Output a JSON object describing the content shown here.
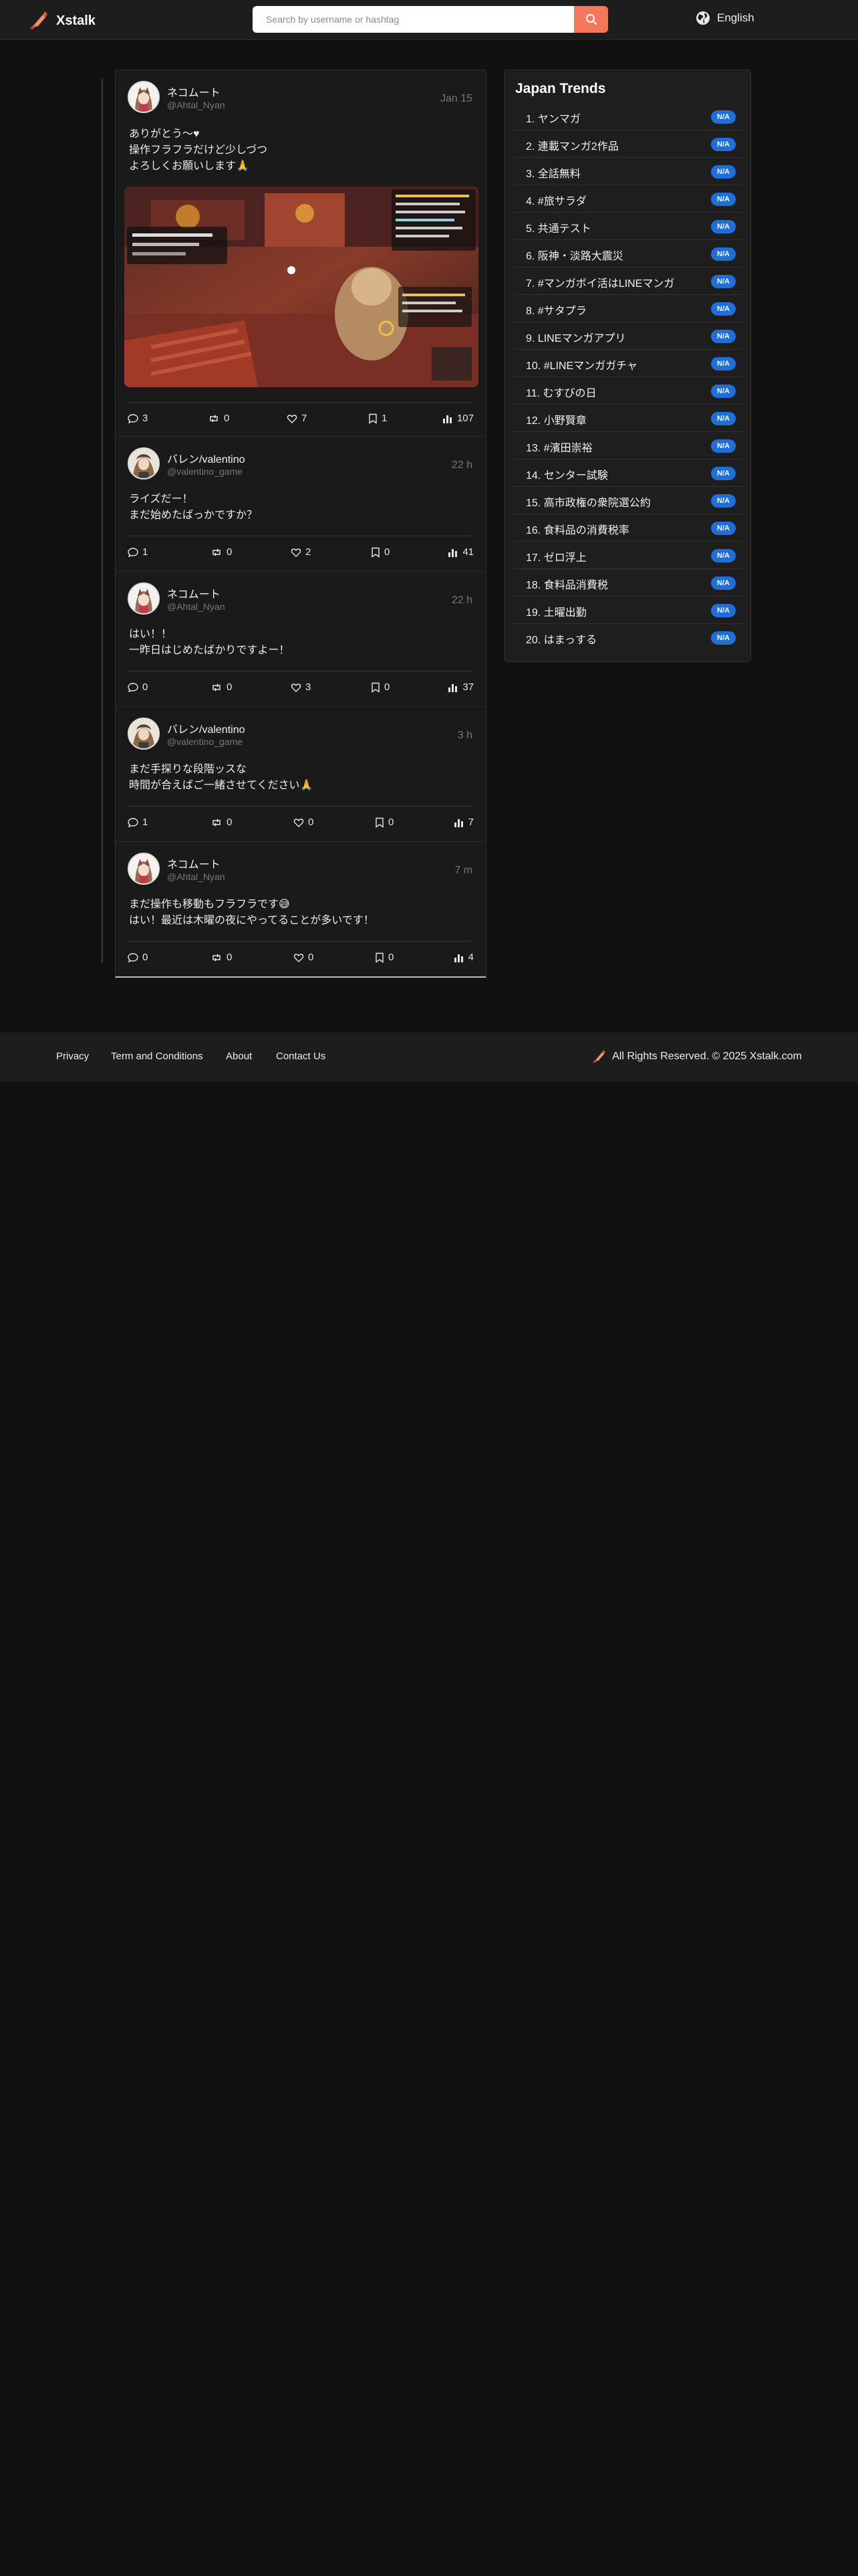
{
  "app": {
    "name": "Xstalk"
  },
  "search": {
    "placeholder": "Search by username or hashtag"
  },
  "language": {
    "label": "English"
  },
  "posts": [
    {
      "name": "ネコムート",
      "handle": "@Ahtal_Nyan",
      "time": "Jan 15",
      "lines": [
        "ありがとう〜♥",
        "操作フラフラだけど少しづつ",
        "よろしくお願いします🙏"
      ],
      "has_image": true,
      "comments": "3",
      "reposts": "0",
      "likes": "7",
      "bookmarks": "1",
      "views": "107"
    },
    {
      "name": "バレン/valentino",
      "handle": "@valentino_game",
      "time": "22 h",
      "lines": [
        "ライズだー！",
        "まだ始めたばっかですか？"
      ],
      "comments": "1",
      "reposts": "0",
      "likes": "2",
      "bookmarks": "0",
      "views": "41"
    },
    {
      "name": "ネコムート",
      "handle": "@Ahtal_Nyan",
      "time": "22 h",
      "lines": [
        "はい！！",
        "一昨日はじめたばかりですよー！"
      ],
      "comments": "0",
      "reposts": "0",
      "likes": "3",
      "bookmarks": "0",
      "views": "37"
    },
    {
      "name": "バレン/valentino",
      "handle": "@valentino_game",
      "time": "3 h",
      "lines": [
        "まだ手探りな段階ッスな",
        "時間が合えばご一緒させてください🙏"
      ],
      "comments": "1",
      "reposts": "0",
      "likes": "0",
      "bookmarks": "0",
      "views": "7"
    },
    {
      "name": "ネコムート",
      "handle": "@Ahtal_Nyan",
      "time": "7 m",
      "lines": [
        "まだ操作も移動もフラフラです😅",
        "はい！最近は木曜の夜にやってることが多いです！"
      ],
      "comments": "0",
      "reposts": "0",
      "likes": "0",
      "bookmarks": "0",
      "views": "4"
    }
  ],
  "trends": {
    "title": "Japan Trends",
    "badge": "N/A",
    "items": [
      "1. ヤンマガ",
      "2. 連載マンガ2作品",
      "3. 全話無料",
      "4. #旅サラダ",
      "5. 共通テスト",
      "6. 阪神・淡路大震災",
      "7. #マンガボイ活はLINEマンガ",
      "8. #サタプラ",
      "9. LINEマンガアプリ",
      "10. #LINEマンガガチャ",
      "11. むすびの日",
      "12. 小野賢章",
      "13. #濱田崇裕",
      "14. センター試験",
      "15. 高市政権の衆院選公約",
      "16. 食料品の消費税率",
      "17. ゼロ浮上",
      "18. 食料品消費税",
      "19. 土曜出勤",
      "20. はまっする"
    ]
  },
  "footer": {
    "links": [
      "Privacy",
      "Term and Conditions",
      "About",
      "Contact Us"
    ],
    "copyright": "All Rights Reserved. © 2025 Xstalk.com"
  },
  "colors": {
    "background": "#111111",
    "accent": "#f2775b",
    "badge": "#1e6fd9"
  },
  "icons": [
    "logo-icon",
    "search-icon",
    "globe-icon",
    "comment-icon",
    "repost-icon",
    "heart-icon",
    "bookmark-icon",
    "views-icon"
  ]
}
